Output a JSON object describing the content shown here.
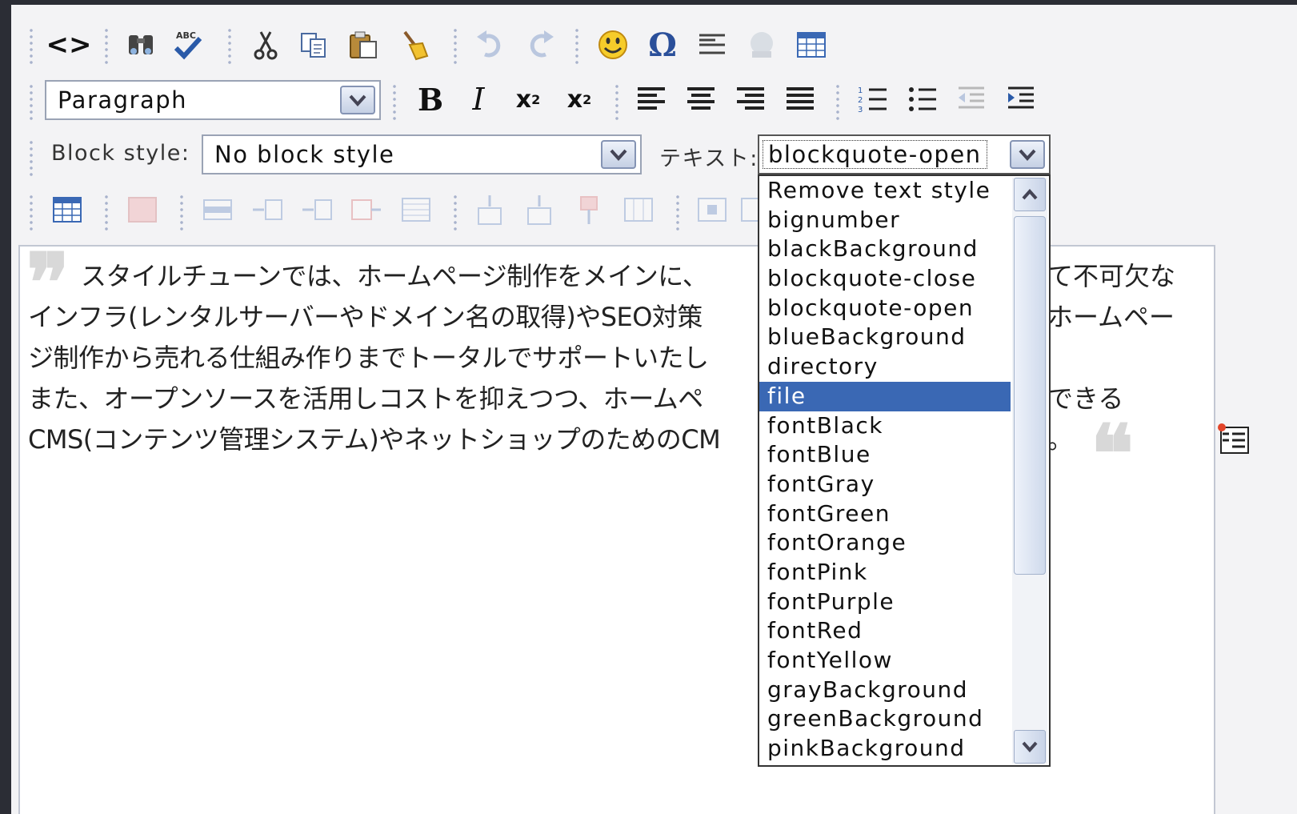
{
  "toolbar_row1": {
    "icons": [
      "source-code-icon",
      "find-icon",
      "spellcheck-icon",
      "cut-icon",
      "copy-icon",
      "paste-icon",
      "cleanup-icon",
      "undo-icon",
      "redo-icon",
      "emoticon-icon",
      "special-char-icon",
      "horizontal-rule-icon",
      "image-icon",
      "table-icon"
    ],
    "source_glyph": "<>",
    "omega_glyph": "Ω"
  },
  "toolbar_row2": {
    "format_select_value": "Paragraph",
    "bold": "B",
    "italic": "I",
    "subscript": "x",
    "subscript_mark": "2",
    "superscript": "x",
    "superscript_mark": "2"
  },
  "toolbar_row3": {
    "block_style_label": "Block style:",
    "block_style_value": "No block style",
    "text_style_label": "テキスト:",
    "text_style_value": "blockquote-open"
  },
  "toolbar_row4": {
    "icons": [
      "table-insert-icon",
      "table-delete-icon",
      "row-props-icon",
      "row-insert-before-icon",
      "row-insert-after-icon",
      "row-delete-icon",
      "row-split-icon",
      "col-insert-before-icon",
      "col-insert-after-icon",
      "col-delete-icon",
      "col-props-icon",
      "cell-props-icon",
      "cell-merge-icon"
    ]
  },
  "editor": {
    "quote_open": "❞",
    "quote_close": "❝",
    "lines": [
      "スタイルチューンでは、ホームページ制作をメインに、",
      "インフラ(レンタルサーバーやドメイン名の取得)やSEO対策",
      "ジ制作から売れる仕組み作りまでトータルでサポートいたし",
      "また、オープンソースを活用しコストを抑えつつ、ホームペ",
      "CMS(コンテンツ管理システム)やネットショップのためのCM"
    ],
    "lines_right": [
      "て不可欠な",
      "ホームペー",
      "",
      "できる",
      "。"
    ]
  },
  "dropdown": {
    "selected": "file",
    "options": [
      "Remove text style",
      "bignumber",
      "blackBackground",
      "blockquote-close",
      "blockquote-open",
      "blueBackground",
      "directory",
      "file",
      "fontBlack",
      "fontBlue",
      "fontGray",
      "fontGreen",
      "fontOrange",
      "fontPink",
      "fontPurple",
      "fontRed",
      "fontYellow",
      "grayBackground",
      "greenBackground",
      "pinkBackground"
    ]
  },
  "colors": {
    "selection": "#3a68b4",
    "toolbar_bg": "#f3f3f5",
    "page_bg": "#2b2d35"
  }
}
